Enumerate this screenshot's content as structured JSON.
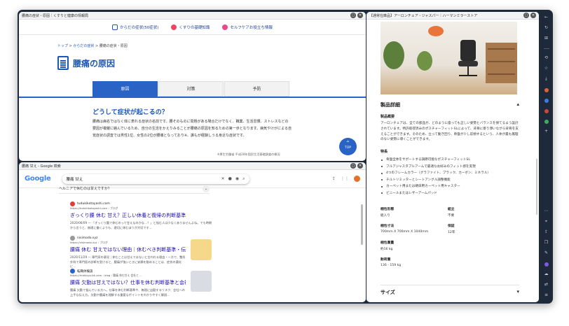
{
  "window1": {
    "title": "腰痛の症状・原因｜くすりと健康の情報局",
    "subnav": [
      "からだの症状(50症状)",
      "くすりの基礎知識",
      "セルフケアお役立ち情報"
    ],
    "breadcrumb": [
      "トップ",
      "からだの症状",
      "腰痛の症状・原因"
    ],
    "breadcrumb_sep": " > ",
    "page_title": "腰痛の原因",
    "tabs": [
      "原因",
      "対策",
      "予防"
    ],
    "heading": "どうして症状が起こるの？",
    "body": "腰痛は病名ではなく体に表れる症状の名前です。腰そのものに問題がある場合だけでなく、職業、生活習慣、ストレスなどの要因が複雑に絡んでいるため、自分の生活をかえりみることが腰痛の原因を知るための第一歩となります。病気やけがによる自覚症状の調査では男性1位、女性の2位が腰痛となっており※、誰もが経験しうる身近な症状です。",
    "note": "※厚生労働省 平成28年国民生活基礎調査の概況",
    "top_button": "TOP"
  },
  "window2": {
    "title": "腰痛 甘え - Google 検索",
    "logo": "Google",
    "query": "腰痛 甘え",
    "paa": "ヘルニアで休むのは甘えですか？",
    "results": [
      {
        "site": "tudukikotayashi.com",
        "url": "https://tudukikotayashi.com › ブログ",
        "title": "ぎっくり腰 休む 甘え？正しい休養と復帰の判断基準",
        "snippet": "2020/06/09 — 「ぎっくり腰で休むのって甘えなのかな…？」と悩む人は少なくありませんよね。でも時期から言うと、無理に働くよりも、適切に休むほうが大切です..."
      },
      {
        "site": "nisimodo.xyz",
        "url": "https://nisimodo.xyz › ブログ",
        "title": "腰痛 休む 甘えではない理由｜休むべき判断基準・伝え方 ...",
        "snippet": "2020/11/29 — 専門家の意見｜休むことは甘えではないと言われる理由・一方で、整形外科で専門医の診断を受けると、腰痛が強いときに安静を勧めることは、症状の悪化に..."
      },
      {
        "site": "転職体験談",
        "url": "https://rirekisyo-bk.com › blog › 腰痛 休む甘え 会社と ...",
        "title": "腰痛 欠勤は甘えではない？仕事を休む判断基準と会社への",
        "snippet": "腰痛 欠勤で悩んでいる方へ。仕事を休む判断基準や、無理に出勤するリスク、会社への上手な伝え方。欠勤や腰痛を理解する重要なポイントをわかりやすく解説..."
      }
    ]
  },
  "window3": {
    "title": "【通常在庫品】アーロンチェア・ジャスパー｜ハーマンミラーストア",
    "product_details_heading": "製品詳細",
    "overview_label": "製品概要",
    "overview_text": "アーロンチェアは、全ての部品が、どのように座っても正しい姿勢とバランスを保てるよう設計されています。特許取得済みのポスチャーフィットSLによって、背骨に寄り添いながら背骨を支えることができます。そのため、立って動き回り、骨盤が少し前傾するという、人体が最も無理のない姿勢に導くことができます。",
    "features_label": "特長",
    "features": [
      "骨盤全体をサポートする調節可能なポスチャーフィットSL",
      "フルアジャスタブルアームで最適なお好みのフィット感を実現",
      "4つのフレームカラー（グラファイト、ブラック、カーボン、ミネラル）",
      "チルトリミッターとシートアングル調整機能",
      "カーペット用または硬床用カーペット用キャスター",
      "ビニールまたはレザーアームパッド"
    ],
    "specs": [
      {
        "k": "梱包形態",
        "v": "組入り"
      },
      {
        "k": "組立",
        "v": "不要"
      },
      {
        "k": "梱包寸法",
        "v": "700mm X 700mm X 1040mm"
      },
      {
        "k": "保証",
        "v": "12年"
      },
      {
        "k": "梱包重量",
        "v": "約16 kg"
      },
      {
        "k": "",
        "v": ""
      },
      {
        "k": "耐荷重",
        "v": "136 - 159 kg"
      }
    ],
    "size_heading": "サイズ"
  },
  "colors": {
    "accent": "#2a63c6",
    "link": "#1a0dab",
    "frame": "#1e2a3a"
  }
}
